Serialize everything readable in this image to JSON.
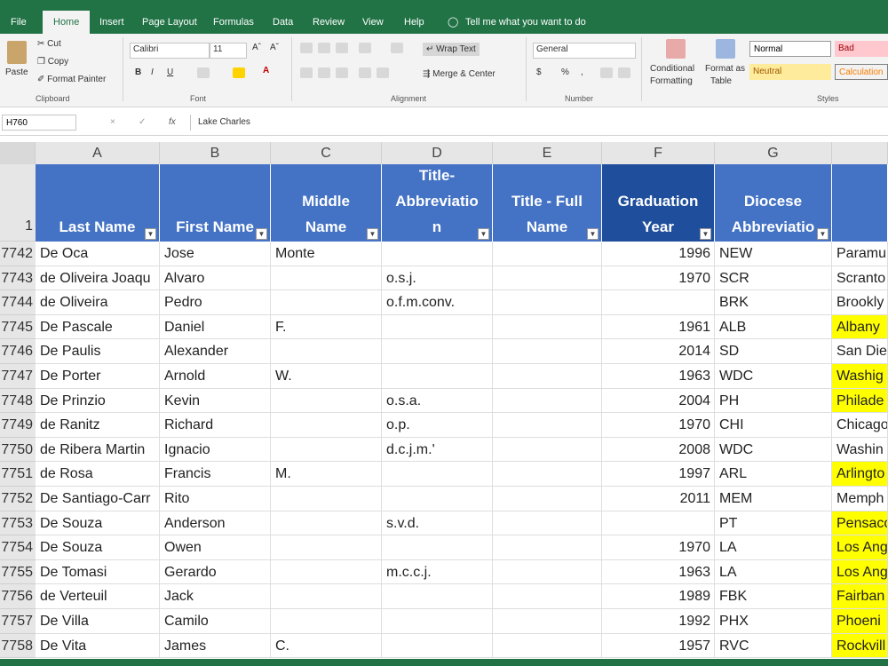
{
  "ribbon_tabs": [
    "File",
    "Home",
    "Insert",
    "Page Layout",
    "Formulas",
    "Data",
    "Review",
    "View",
    "Help",
    "Tell me what you want to do"
  ],
  "clipboard": {
    "paste": "Paste",
    "cut": "Cut",
    "copy": "Copy",
    "format_painter": "Format Painter",
    "label": "Clipboard"
  },
  "font": {
    "name": "Calibri",
    "size": "11",
    "bold": "B",
    "italic": "I",
    "underline": "U",
    "label": "Font"
  },
  "alignment": {
    "wrap": "Wrap Text",
    "merge": "Merge & Center",
    "label": "Alignment"
  },
  "number": {
    "format": "General",
    "currency": "$",
    "percent": "%",
    "comma": ",",
    "label": "Number"
  },
  "styles": {
    "conditional": "Conditional",
    "formatting": "Formatting",
    "format_as": "Format as",
    "table": "Table",
    "normal": "Normal",
    "bad": "Bad",
    "neutral": "Neutral",
    "calculation": "Calculation",
    "label": "Styles"
  },
  "formula_bar": {
    "name_box": "H760",
    "value": "Lake Charles"
  },
  "columns": [
    "A",
    "B",
    "C",
    "D",
    "E",
    "F",
    "G"
  ],
  "header_row_num": "1",
  "headers": [
    {
      "lines": [
        "Last Name"
      ]
    },
    {
      "lines": [
        "First Name"
      ]
    },
    {
      "lines": [
        "Middle",
        "Name"
      ]
    },
    {
      "lines": [
        "Title-",
        "Abbreviatio",
        "n"
      ]
    },
    {
      "lines": [
        "Title - Full",
        "Name"
      ]
    },
    {
      "lines": [
        "Graduation",
        "Year"
      ]
    },
    {
      "lines": [
        "Diocese",
        "Abbreviatio"
      ]
    }
  ],
  "rows": [
    {
      "num": "7742",
      "last": "De Oca",
      "first": "Jose",
      "middle": "Monte",
      "title": "",
      "full": "",
      "year": "1996",
      "diocese": "NEW",
      "city": "Paramu",
      "hl": false
    },
    {
      "num": "7743",
      "last": "de Oliveira Joaqu",
      "first": "Alvaro",
      "middle": "",
      "title": "o.s.j.",
      "full": "",
      "year": "1970",
      "diocese": "SCR",
      "city": "Scranto",
      "hl": false
    },
    {
      "num": "7744",
      "last": "de Oliveira",
      "first": "Pedro",
      "middle": "",
      "title": "o.f.m.conv.",
      "full": "",
      "year": "",
      "diocese": "BRK",
      "city": "Brookly",
      "hl": false
    },
    {
      "num": "7745",
      "last": "De Pascale",
      "first": "Daniel",
      "middle": "F.",
      "title": "",
      "full": "",
      "year": "1961",
      "diocese": "ALB",
      "city": "Albany",
      "hl": true
    },
    {
      "num": "7746",
      "last": "De Paulis",
      "first": "Alexander",
      "middle": "",
      "title": "",
      "full": "",
      "year": "2014",
      "diocese": "SD",
      "city": "San Die",
      "hl": false
    },
    {
      "num": "7747",
      "last": "De Porter",
      "first": "Arnold",
      "middle": "W.",
      "title": "",
      "full": "",
      "year": "1963",
      "diocese": "WDC",
      "city": "Washig",
      "hl": true
    },
    {
      "num": "7748",
      "last": "De Prinzio",
      "first": "Kevin",
      "middle": "",
      "title": "o.s.a.",
      "full": "",
      "year": "2004",
      "diocese": "PH",
      "city": "Philade",
      "hl": true
    },
    {
      "num": "7749",
      "last": "de Ranitz",
      "first": "Richard",
      "middle": "",
      "title": "o.p.",
      "full": "",
      "year": "1970",
      "diocese": "CHI",
      "city": "Chicago",
      "hl": false
    },
    {
      "num": "7750",
      "last": "de Ribera Martin",
      "first": "Ignacio",
      "middle": "",
      "title": "d.c.j.m.'",
      "full": "",
      "year": "2008",
      "diocese": "WDC",
      "city": "Washin",
      "hl": false
    },
    {
      "num": "7751",
      "last": "de Rosa",
      "first": "Francis",
      "middle": "M.",
      "title": "",
      "full": "",
      "year": "1997",
      "diocese": "ARL",
      "city": "Arlingto",
      "hl": true
    },
    {
      "num": "7752",
      "last": "De Santiago-Carr",
      "first": "Rito",
      "middle": "",
      "title": "",
      "full": "",
      "year": "2011",
      "diocese": "MEM",
      "city": "Memph",
      "hl": false
    },
    {
      "num": "7753",
      "last": "De Souza",
      "first": "Anderson",
      "middle": "",
      "title": "s.v.d.",
      "full": "",
      "year": "",
      "diocese": "PT",
      "city": "Pensaco",
      "hl": true
    },
    {
      "num": "7754",
      "last": "De Souza",
      "first": "Owen",
      "middle": "",
      "title": "",
      "full": "",
      "year": "1970",
      "diocese": "LA",
      "city": "Los Ang",
      "hl": true
    },
    {
      "num": "7755",
      "last": "De Tomasi",
      "first": "Gerardo",
      "middle": "",
      "title": "m.c.c.j.",
      "full": "",
      "year": "1963",
      "diocese": "LA",
      "city": "Los Ang",
      "hl": true
    },
    {
      "num": "7756",
      "last": "de Verteuil",
      "first": "Jack",
      "middle": "",
      "title": "",
      "full": "",
      "year": "1989",
      "diocese": "FBK",
      "city": "Fairban",
      "hl": true
    },
    {
      "num": "7757",
      "last": "De Villa",
      "first": "Camilo",
      "middle": "",
      "title": "",
      "full": "",
      "year": "1992",
      "diocese": "PHX",
      "city": "Phoeni",
      "hl": true
    },
    {
      "num": "7758",
      "last": "De Vita",
      "first": "James",
      "middle": "C.",
      "title": "",
      "full": "",
      "year": "1957",
      "diocese": "RVC",
      "city": "Rockvill",
      "hl": true
    }
  ],
  "colors": {
    "excel_green": "#217346",
    "header_blue": "#4472c4",
    "header_dark_blue": "#1f4e9c",
    "highlight": "#ffff00"
  }
}
